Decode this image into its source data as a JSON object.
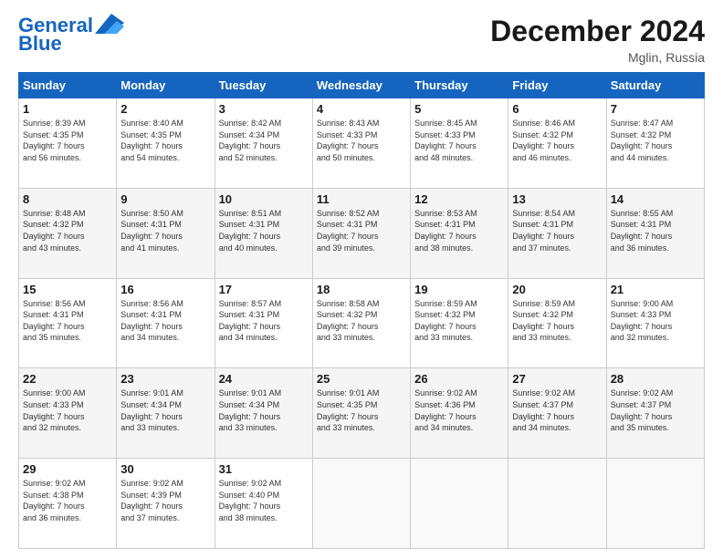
{
  "header": {
    "logo_line1": "General",
    "logo_line2": "Blue",
    "month": "December 2024",
    "location": "Mglin, Russia"
  },
  "days_of_week": [
    "Sunday",
    "Monday",
    "Tuesday",
    "Wednesday",
    "Thursday",
    "Friday",
    "Saturday"
  ],
  "weeks": [
    [
      {
        "day": "1",
        "info": "Sunrise: 8:39 AM\nSunset: 4:35 PM\nDaylight: 7 hours\nand 56 minutes."
      },
      {
        "day": "2",
        "info": "Sunrise: 8:40 AM\nSunset: 4:35 PM\nDaylight: 7 hours\nand 54 minutes."
      },
      {
        "day": "3",
        "info": "Sunrise: 8:42 AM\nSunset: 4:34 PM\nDaylight: 7 hours\nand 52 minutes."
      },
      {
        "day": "4",
        "info": "Sunrise: 8:43 AM\nSunset: 4:33 PM\nDaylight: 7 hours\nand 50 minutes."
      },
      {
        "day": "5",
        "info": "Sunrise: 8:45 AM\nSunset: 4:33 PM\nDaylight: 7 hours\nand 48 minutes."
      },
      {
        "day": "6",
        "info": "Sunrise: 8:46 AM\nSunset: 4:32 PM\nDaylight: 7 hours\nand 46 minutes."
      },
      {
        "day": "7",
        "info": "Sunrise: 8:47 AM\nSunset: 4:32 PM\nDaylight: 7 hours\nand 44 minutes."
      }
    ],
    [
      {
        "day": "8",
        "info": "Sunrise: 8:48 AM\nSunset: 4:32 PM\nDaylight: 7 hours\nand 43 minutes."
      },
      {
        "day": "9",
        "info": "Sunrise: 8:50 AM\nSunset: 4:31 PM\nDaylight: 7 hours\nand 41 minutes."
      },
      {
        "day": "10",
        "info": "Sunrise: 8:51 AM\nSunset: 4:31 PM\nDaylight: 7 hours\nand 40 minutes."
      },
      {
        "day": "11",
        "info": "Sunrise: 8:52 AM\nSunset: 4:31 PM\nDaylight: 7 hours\nand 39 minutes."
      },
      {
        "day": "12",
        "info": "Sunrise: 8:53 AM\nSunset: 4:31 PM\nDaylight: 7 hours\nand 38 minutes."
      },
      {
        "day": "13",
        "info": "Sunrise: 8:54 AM\nSunset: 4:31 PM\nDaylight: 7 hours\nand 37 minutes."
      },
      {
        "day": "14",
        "info": "Sunrise: 8:55 AM\nSunset: 4:31 PM\nDaylight: 7 hours\nand 36 minutes."
      }
    ],
    [
      {
        "day": "15",
        "info": "Sunrise: 8:56 AM\nSunset: 4:31 PM\nDaylight: 7 hours\nand 35 minutes."
      },
      {
        "day": "16",
        "info": "Sunrise: 8:56 AM\nSunset: 4:31 PM\nDaylight: 7 hours\nand 34 minutes."
      },
      {
        "day": "17",
        "info": "Sunrise: 8:57 AM\nSunset: 4:31 PM\nDaylight: 7 hours\nand 34 minutes."
      },
      {
        "day": "18",
        "info": "Sunrise: 8:58 AM\nSunset: 4:32 PM\nDaylight: 7 hours\nand 33 minutes."
      },
      {
        "day": "19",
        "info": "Sunrise: 8:59 AM\nSunset: 4:32 PM\nDaylight: 7 hours\nand 33 minutes."
      },
      {
        "day": "20",
        "info": "Sunrise: 8:59 AM\nSunset: 4:32 PM\nDaylight: 7 hours\nand 33 minutes."
      },
      {
        "day": "21",
        "info": "Sunrise: 9:00 AM\nSunset: 4:33 PM\nDaylight: 7 hours\nand 32 minutes."
      }
    ],
    [
      {
        "day": "22",
        "info": "Sunrise: 9:00 AM\nSunset: 4:33 PM\nDaylight: 7 hours\nand 32 minutes."
      },
      {
        "day": "23",
        "info": "Sunrise: 9:01 AM\nSunset: 4:34 PM\nDaylight: 7 hours\nand 33 minutes."
      },
      {
        "day": "24",
        "info": "Sunrise: 9:01 AM\nSunset: 4:34 PM\nDaylight: 7 hours\nand 33 minutes."
      },
      {
        "day": "25",
        "info": "Sunrise: 9:01 AM\nSunset: 4:35 PM\nDaylight: 7 hours\nand 33 minutes."
      },
      {
        "day": "26",
        "info": "Sunrise: 9:02 AM\nSunset: 4:36 PM\nDaylight: 7 hours\nand 34 minutes."
      },
      {
        "day": "27",
        "info": "Sunrise: 9:02 AM\nSunset: 4:37 PM\nDaylight: 7 hours\nand 34 minutes."
      },
      {
        "day": "28",
        "info": "Sunrise: 9:02 AM\nSunset: 4:37 PM\nDaylight: 7 hours\nand 35 minutes."
      }
    ],
    [
      {
        "day": "29",
        "info": "Sunrise: 9:02 AM\nSunset: 4:38 PM\nDaylight: 7 hours\nand 36 minutes."
      },
      {
        "day": "30",
        "info": "Sunrise: 9:02 AM\nSunset: 4:39 PM\nDaylight: 7 hours\nand 37 minutes."
      },
      {
        "day": "31",
        "info": "Sunrise: 9:02 AM\nSunset: 4:40 PM\nDaylight: 7 hours\nand 38 minutes."
      },
      {
        "day": "",
        "info": ""
      },
      {
        "day": "",
        "info": ""
      },
      {
        "day": "",
        "info": ""
      },
      {
        "day": "",
        "info": ""
      }
    ]
  ]
}
